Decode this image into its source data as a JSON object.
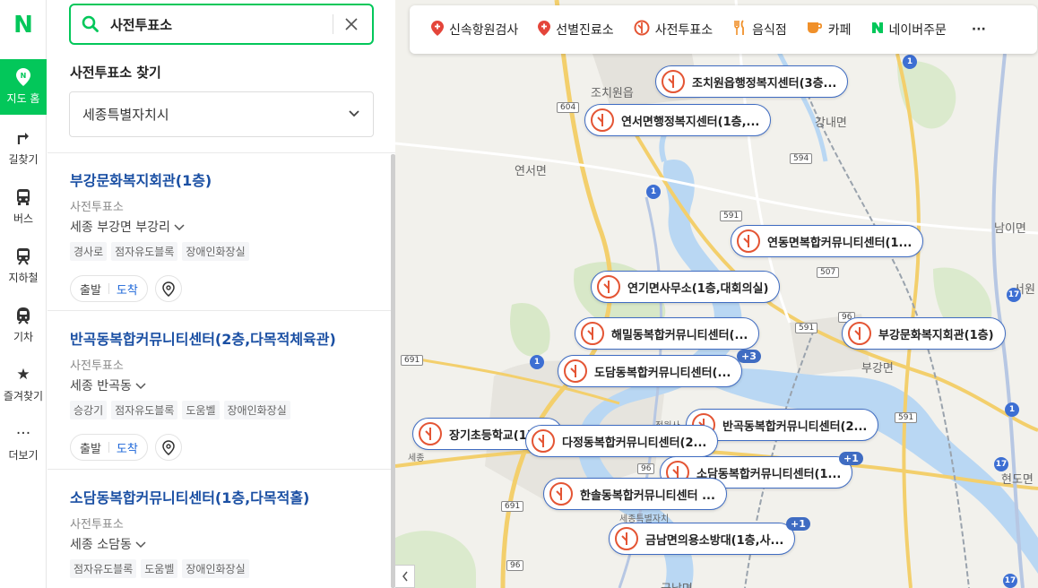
{
  "logo": "N",
  "nav": [
    {
      "icon": "location-pin",
      "label": "지도 홈",
      "active": true
    },
    {
      "icon": "route-arrow",
      "label": "길찾기"
    },
    {
      "icon": "bus",
      "label": "버스"
    },
    {
      "icon": "subway",
      "label": "지하철"
    },
    {
      "icon": "train",
      "label": "기차"
    },
    {
      "icon": "star",
      "label": "즐겨찾기"
    },
    {
      "icon": "more-dots",
      "label": "더보기"
    }
  ],
  "search": {
    "query": "사전투표소",
    "placeholder": ""
  },
  "panel": {
    "title": "사전투표소 찾기",
    "region": "세종특별자치시"
  },
  "results": [
    {
      "name": "부강문화복지회관(1층)",
      "category": "사전투표소",
      "address": "세종 부강면 부강리",
      "tags": [
        "경사로",
        "점자유도블록",
        "장애인화장실"
      ],
      "start": "출발",
      "arrive": "도착"
    },
    {
      "name": "반곡동복합커뮤니티센터(2층,다목적체육관)",
      "category": "사전투표소",
      "address": "세종 반곡동",
      "tags": [
        "승강기",
        "점자유도블록",
        "도움벨",
        "장애인화장실"
      ],
      "start": "출발",
      "arrive": "도착"
    },
    {
      "name": "소담동복합커뮤니티센터(1층,다목적홀)",
      "category": "사전투표소",
      "address": "세종 소담동",
      "tags": [
        "점자유도블록",
        "도움벨",
        "장애인화장실"
      ],
      "start": "출발",
      "arrive": "도착"
    }
  ],
  "filters": [
    {
      "icon": "pin-icon",
      "label": "신속항원검사",
      "color": "#e4453a"
    },
    {
      "icon": "pin-icon",
      "label": "선별진료소",
      "color": "#e4453a"
    },
    {
      "icon": "vote-icon",
      "label": "사전투표소",
      "color": "#e45534"
    },
    {
      "icon": "fork-icon",
      "label": "음식점",
      "color": "#f0902a"
    },
    {
      "icon": "cup-icon",
      "label": "카페",
      "color": "#f0902a"
    },
    {
      "icon": "naver-icon",
      "label": "네이버주문",
      "color": "#03c75a"
    }
  ],
  "filters_more": "···",
  "markers": [
    {
      "label": "조치원읍행정복지센터(3층..."
    },
    {
      "label": "연서면행정복지센터(1층,..."
    },
    {
      "label": "연동면복합커뮤니티센터(1..."
    },
    {
      "label": "연기면사무소(1층,대회의실)"
    },
    {
      "label": "해밀동복합커뮤니티센터(..."
    },
    {
      "label": "부강문화복지회관(1층)"
    },
    {
      "label": "도담동복합커뮤니티센터(..."
    },
    {
      "label": "반곡동복합커뮤니티센터(2..."
    },
    {
      "label": "장기초등학교(1층..."
    },
    {
      "label": "다정동복합커뮤니티센터(2..."
    },
    {
      "label": "소담동복합커뮤니티센터(1..."
    },
    {
      "label": "한솔동복합커뮤니티센터 ..."
    },
    {
      "label": "금남면의용소방대(1층,사..."
    }
  ],
  "badges": [
    "+3",
    "+1",
    "+1"
  ],
  "places": [
    "연서면",
    "강내면",
    "조치원읍",
    "부강면",
    "남이면",
    "서원",
    "현도면",
    "금남면",
    "세종",
    "정원사",
    "세종특별자치"
  ],
  "roads": [
    "604",
    "594",
    "591",
    "507",
    "96",
    "691",
    "591",
    "591",
    "96",
    "691",
    "96"
  ],
  "national_roads": [
    "1",
    "1",
    "1",
    "17",
    "1",
    "17",
    "17"
  ],
  "colors": {
    "brand": "#03c75a",
    "link": "#1a4fa3",
    "marker_border": "#3f6cc2",
    "vote_red": "#e45534"
  }
}
